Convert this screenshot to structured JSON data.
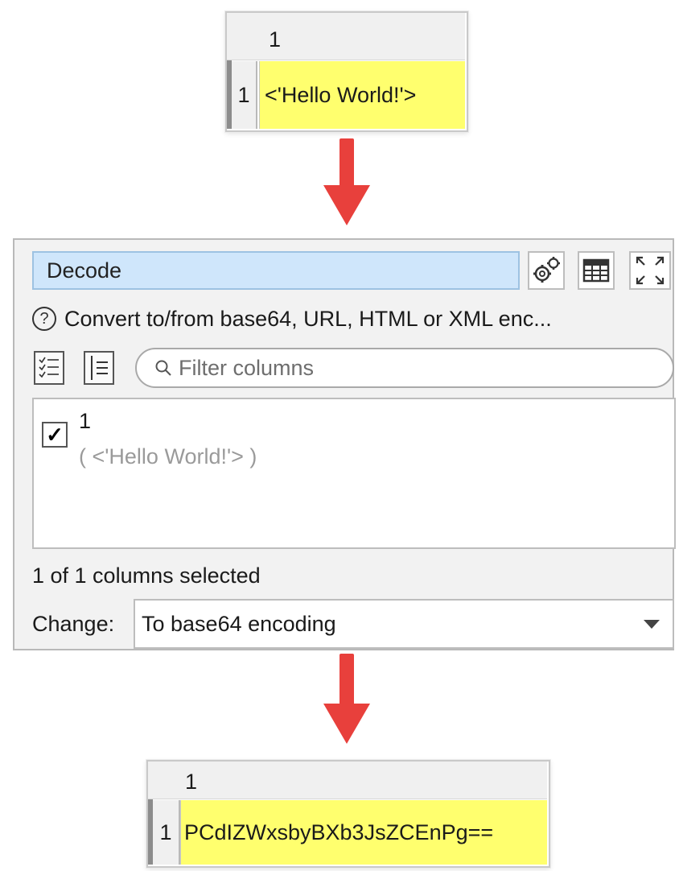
{
  "input_table": {
    "column_header": "1",
    "row_number": "1",
    "cell_value": "<'Hello World!'>"
  },
  "dialog": {
    "title": "Decode",
    "description": "Convert to/from base64, URL, HTML or XML enc...",
    "filter_placeholder": "Filter columns",
    "columns": [
      {
        "name": "1",
        "sample": "( <'Hello World!'> )",
        "checked": true
      }
    ],
    "status": "1 of 1 columns selected",
    "change_label": "Change:",
    "change_value": "To base64 encoding"
  },
  "output_table": {
    "column_header": "1",
    "row_number": "1",
    "cell_value": "PCdIZWxsbyBXb3JsZCEnPg=="
  },
  "colors": {
    "highlight_cell": "#ffff6e",
    "arrow": "#e8403c",
    "title_background": "#cfe6fb"
  },
  "icons": {
    "settings": "gears-icon",
    "table_view": "table-icon",
    "maximize": "expand-icon",
    "help": "help-icon",
    "select_all": "checklist-icon",
    "select_none": "list-icon",
    "search": "search-icon",
    "dropdown": "chevron-down-icon"
  }
}
